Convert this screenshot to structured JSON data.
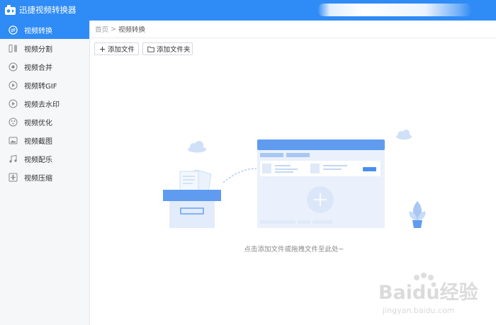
{
  "app": {
    "title": "迅捷视频转换器"
  },
  "sidebar": {
    "items": [
      {
        "label": "视频转换",
        "icon": "convert-icon",
        "active": true
      },
      {
        "label": "视频分割",
        "icon": "split-icon",
        "active": false
      },
      {
        "label": "视频合并",
        "icon": "merge-icon",
        "active": false
      },
      {
        "label": "视频转GIF",
        "icon": "gif-icon",
        "active": false
      },
      {
        "label": "视频去水印",
        "icon": "watermark-remove-icon",
        "active": false
      },
      {
        "label": "视频优化",
        "icon": "optimize-icon",
        "active": false
      },
      {
        "label": "视频截图",
        "icon": "screenshot-icon",
        "active": false
      },
      {
        "label": "视频配乐",
        "icon": "music-icon",
        "active": false
      },
      {
        "label": "视频压缩",
        "icon": "compress-icon",
        "active": false
      }
    ]
  },
  "breadcrumb": {
    "home": "首页",
    "separator": ">",
    "current": "视频转换"
  },
  "toolbar": {
    "add_file_label": "添加文件",
    "add_folder_label": "添加文件夹"
  },
  "main": {
    "hint": "点击添加文件或拖拽文件至此处~"
  },
  "watermark": {
    "brand": "Baidu经验",
    "url": "jingyan.baidu.com"
  },
  "colors": {
    "accent": "#2f8bf5",
    "sidebar_bg": "#f6f7f9"
  }
}
